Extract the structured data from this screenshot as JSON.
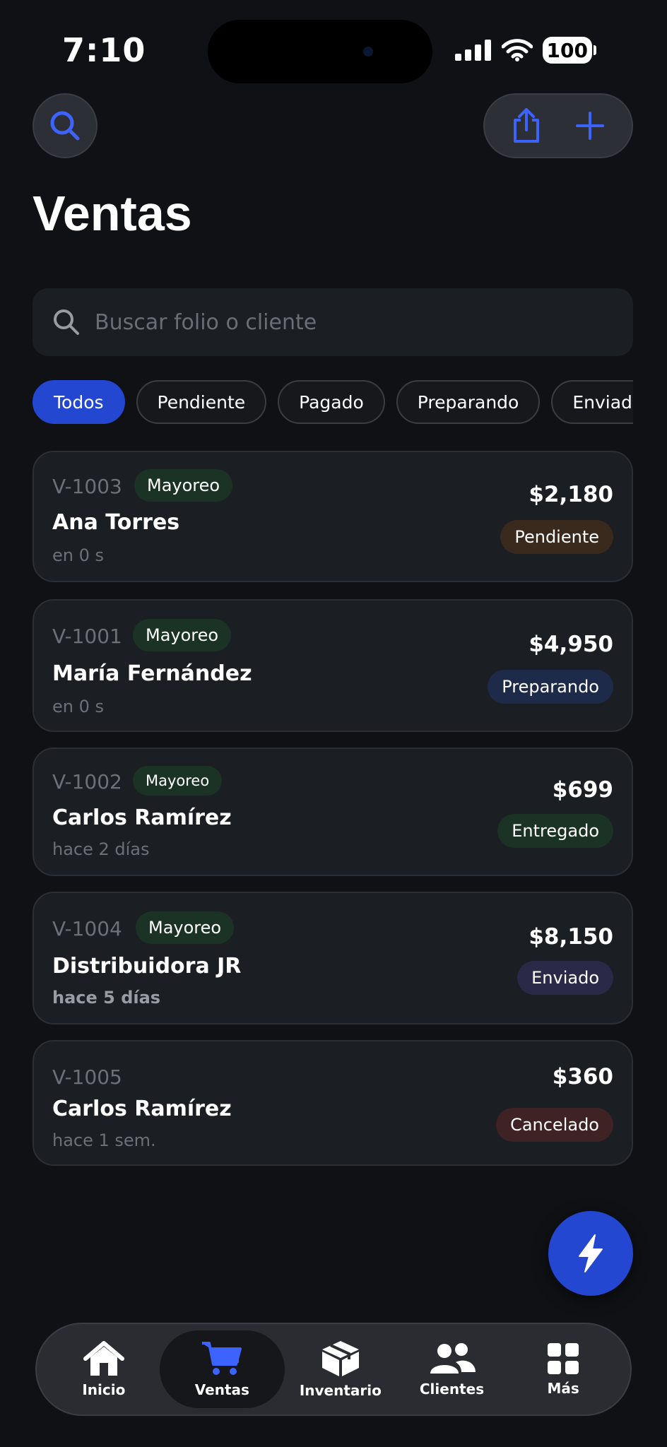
{
  "status_bar": {
    "time": "7:10",
    "battery": "100"
  },
  "header": {
    "title": "Ventas"
  },
  "search": {
    "placeholder": "Buscar folio o cliente"
  },
  "filters": [
    "Todos",
    "Pendiente",
    "Pagado",
    "Preparando",
    "Enviado"
  ],
  "orders": [
    {
      "folio": "V-1003",
      "tag": "Mayoreo",
      "client": "Ana Torres",
      "time": "en 0 s",
      "amount": "$2,180",
      "status": "Pendiente"
    },
    {
      "folio": "V-1001",
      "tag": "Mayoreo",
      "client": "María Fernández",
      "time": "en 0 s",
      "amount": "$4,950",
      "status": "Preparando"
    },
    {
      "folio": "V-1002",
      "tag": "Mayoreo",
      "client": "Carlos Ramírez",
      "time": "hace 2 días",
      "amount": "$699",
      "status": "Entregado"
    },
    {
      "folio": "V-1004",
      "tag": "Mayoreo",
      "client": "Distribuidora JR",
      "time": "hace 5 días",
      "amount": "$8,150",
      "status": "Enviado"
    },
    {
      "folio": "V-1005",
      "tag": "",
      "client": "Carlos Ramírez",
      "time": "hace 1 sem.",
      "amount": "$360",
      "status": "Cancelado"
    }
  ],
  "status_colors": {
    "Pendiente": "#3a2a1e",
    "Preparando": "#1e2a4a",
    "Entregado": "#1b3325",
    "Enviado": "#2a2a48",
    "Cancelado": "#3f2224"
  },
  "accent": "#2347d0",
  "tabbar": [
    {
      "label": "Inicio",
      "icon": "home-icon"
    },
    {
      "label": "Ventas",
      "icon": "cart-icon"
    },
    {
      "label": "Inventario",
      "icon": "box-icon"
    },
    {
      "label": "Clientes",
      "icon": "people-icon"
    },
    {
      "label": "Más",
      "icon": "grid-icon"
    }
  ]
}
